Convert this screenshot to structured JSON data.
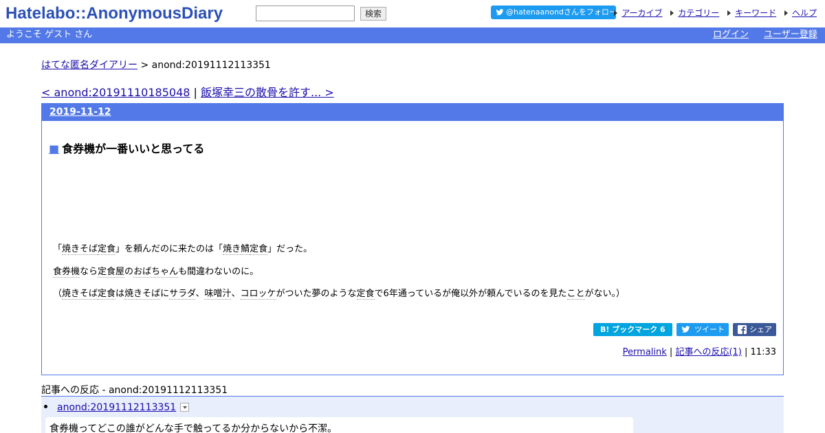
{
  "header": {
    "logo": "Hatelabo::AnonymousDiary",
    "search_button": "検索",
    "follow_label": "@hatenaanondさんをフォロー",
    "links": [
      "アーカイブ",
      "カテゴリー",
      "キーワード",
      "ヘルプ"
    ]
  },
  "bluebar": {
    "welcome": "ようこそ ゲスト さん",
    "login": "ログイン",
    "register": "ユーザー登録"
  },
  "breadcrumb": {
    "home": "はてな匿名ダイアリー",
    "sep": " > ",
    "current": "anond:20191112113351"
  },
  "pager": {
    "prev": "< anond:20191110185048",
    "sep": " | ",
    "next": "飯塚幸三の散骨を許す... >"
  },
  "entry": {
    "date": "2019-11-12",
    "square": "■",
    "title": "食券機が一番いいと思ってる",
    "line1": {
      "a": "「",
      "k1": "焼きそば",
      "b": "",
      "k2": "定食",
      "c": "」を頼んだのに来たのは「",
      "k3": "焼き",
      "k4": "鯖",
      "d": "",
      "k5": "定食",
      "e": "」だった。"
    },
    "line2": {
      "k1": "食券機",
      "a": "なら",
      "k2": "定食屋",
      "b": "の",
      "k3": "おばちゃん",
      "c": "も間違わないのに。"
    },
    "line3": {
      "a": "（",
      "k1": "焼きそば",
      "k2": "定食",
      "b": "は",
      "k3": "焼きそば",
      "c": "に",
      "k4": "サラダ",
      "d": "、",
      "k5": "味噌汁",
      "e": "、",
      "k6": "コロッケ",
      "f": "がついた夢のような",
      "k7": "定食",
      "g": "で6年通っているが俺以外が頼んでいるのを見た",
      "k8": "こと",
      "h": "がない。）"
    },
    "share_hatena": "B! ブックマーク  6",
    "share_tweet": "ツイート",
    "share_fb": "シェア",
    "permalink": "Permalink",
    "sep": " | ",
    "reactions_link": "記事への反応(1)",
    "time": "11:33"
  },
  "reactions": {
    "heading": "記事への反応 - anond:20191112113351",
    "item_link": "anond:20191112113351",
    "comment": "食券機ってどこの誰がどんな手で触ってるか分からないから不潔。"
  },
  "colors": {
    "accent": "#5279e7",
    "link": "#1a0dab",
    "twitter": "#1d9bf0",
    "hatena": "#00a4de",
    "facebook": "#3b5998"
  }
}
